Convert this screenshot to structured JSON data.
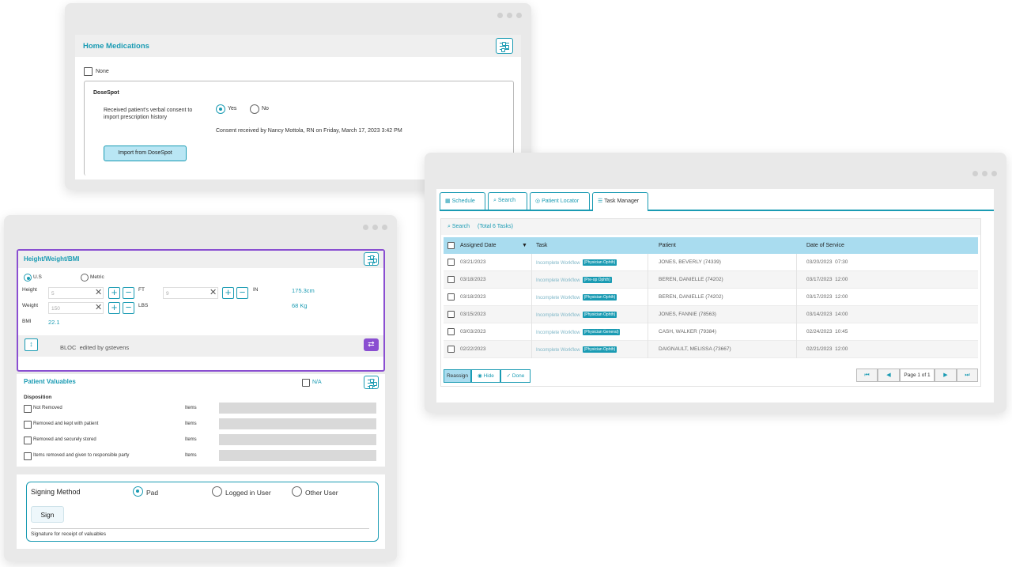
{
  "home_medications": {
    "title": "Home Medications",
    "none_label": "None",
    "dosespot_title": "DoseSpot",
    "consent_question": "Received patient's verbal consent to import prescription history",
    "yes_label": "Yes",
    "no_label": "No",
    "consent_status": "Consent received by Nancy Mottola, RN on Friday, March 17, 2023 3:42 PM",
    "import_button": "Import from DoseSpot"
  },
  "hwbmi": {
    "title": "Height/Weight/BMI",
    "us_label": "U.S",
    "metric_label": "Metric",
    "height_label": "Height",
    "height_ft_value": "5",
    "ft_unit": "FT",
    "height_in_value": "9",
    "in_unit": "IN",
    "height_cm": "175.3cm",
    "weight_label": "Weight",
    "weight_value": "150",
    "lbs_unit": "LBS",
    "weight_kg": "68 Kg",
    "bmi_label": "BMI",
    "bmi_value": "22.1",
    "bloc_text": "BLOC  edited by gstevens"
  },
  "valuables": {
    "title": "Patient Valuables",
    "na_label": "N/A",
    "disposition_label": "Disposition",
    "items_label": "Items",
    "options": [
      "Not Removed",
      "Removed and kept with patient",
      "Removed and securely stored",
      "Items removed and given to responsible party"
    ]
  },
  "signing": {
    "title": "Signing Method",
    "options": [
      "Pad",
      "Logged in User",
      "Other User"
    ],
    "sign_button": "Sign",
    "caption": "Signature for receipt of valuables"
  },
  "task_manager": {
    "tabs": [
      "Schedule",
      "Search",
      "Patient Locator",
      "Task Manager"
    ],
    "search_label": "Search",
    "total_label": "(Total 6 Tasks)",
    "columns": [
      "Assigned Date",
      "Task",
      "Patient",
      "Date of Service"
    ],
    "task_text": "Incomplete Workflow",
    "rows": [
      {
        "date": "03/21/2023",
        "tag": "(Physician Ophth)",
        "patient": "JONES, BEVERLY (74339)",
        "dos": "03/20/2023  07:30"
      },
      {
        "date": "03/18/2023",
        "tag": "(Pre-op Ophth)",
        "patient": "BEREN, DANIELLE (74202)",
        "dos": "03/17/2023  12:00"
      },
      {
        "date": "03/18/2023",
        "tag": "(Physician Ophth)",
        "patient": "BEREN, DANIELLE (74202)",
        "dos": "03/17/2023  12:00"
      },
      {
        "date": "03/15/2023",
        "tag": "(Physician Ophth)",
        "patient": "JONES, FANNIE (78563)",
        "dos": "03/14/2023  14:00"
      },
      {
        "date": "03/03/2023",
        "tag": "(Physician General)",
        "patient": "CASH, WALKER (79384)",
        "dos": "02/24/2023  10:45"
      },
      {
        "date": "02/22/2023",
        "tag": "(Physician Ophth)",
        "patient": "DAIGNAULT, MELISSA (73667)",
        "dos": "02/21/2023  12:00"
      }
    ],
    "reassign_label": "Reassign",
    "hide_label": "Hide",
    "done_label": "Done",
    "page_label": "Page 1 of 1"
  },
  "colors": {
    "accent": "#1a9bb3",
    "header_blue": "#a9dcef",
    "highlight_purple": "#8a4fd1"
  }
}
